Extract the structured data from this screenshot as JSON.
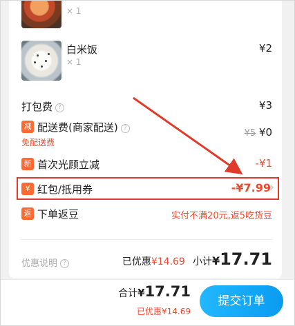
{
  "items": [
    {
      "name": "",
      "qty": "× 1",
      "price": ""
    },
    {
      "name": "白米饭",
      "qty": "× 1",
      "price": "¥2"
    }
  ],
  "packing": {
    "label": "打包费",
    "help": "?",
    "value": "¥3"
  },
  "delivery": {
    "tag": "减",
    "label": "配送费(商家配送)",
    "help": "?",
    "sub": "免配送费",
    "old_price": "¥5",
    "value": "¥0"
  },
  "first_order": {
    "tag": "新",
    "label": "首次光顾立减",
    "value": "-¥1"
  },
  "coupon": {
    "tag": "¥",
    "label": "红包/抵用券",
    "value": "-¥7.99",
    "chevron": "›"
  },
  "rebate": {
    "tag": "返",
    "label": "下单返豆",
    "value": "实付不满20元,返5吃货豆"
  },
  "summary": {
    "note_label": "优惠说明",
    "help": "?",
    "discount_prefix": "已优惠",
    "discount_value": "¥14.69",
    "subtotal_label": "小计",
    "subtotal_currency": "¥",
    "subtotal_value": "17.71"
  },
  "footer": {
    "total_label": "合计",
    "total_currency": "¥",
    "total_value": "17.71",
    "discount_text": "已优惠¥14.69",
    "submit_label": "提交订单"
  },
  "colors": {
    "accent_red": "#f0482d",
    "tag_orange": "#ff6a33",
    "button_blue": "#0a9bf0",
    "annotation_red": "#e03a2a"
  }
}
